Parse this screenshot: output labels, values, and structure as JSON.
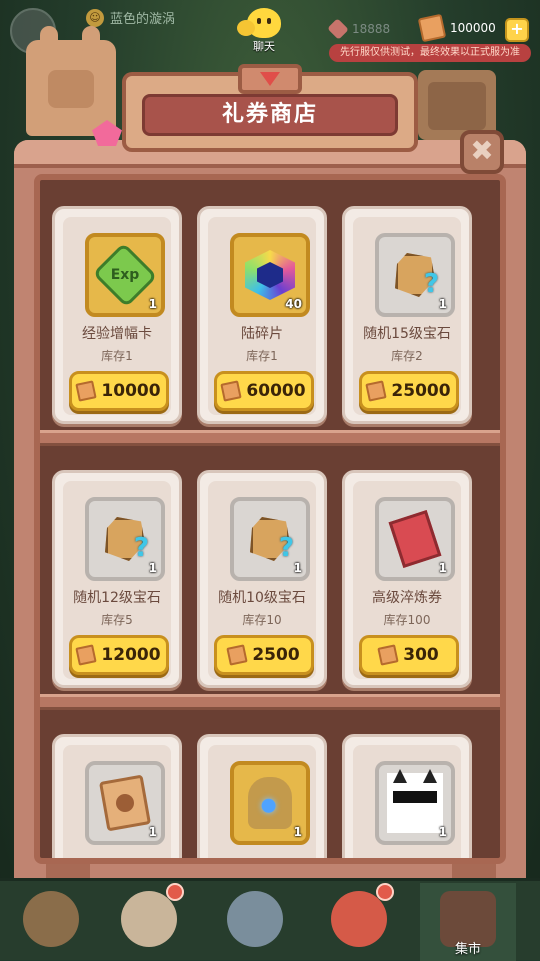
{
  "topbar": {
    "player_name": "蓝色的漩涡",
    "chat_label": "聊天",
    "gems": "18888",
    "coupons": "100000",
    "plus": "+",
    "notice": "先行服仅供测试，最终效果以正式服为准"
  },
  "shop": {
    "title": "礼券商店",
    "close_symbol": "✖",
    "items": [
      {
        "name": "经验增幅卡",
        "stock": "库存1",
        "price": "10000",
        "count": "1",
        "icon": "exp-card-icon",
        "icon_text": "Exp"
      },
      {
        "name": "陆碎片",
        "stock": "库存1",
        "price": "60000",
        "count": "40",
        "icon": "shard-icon"
      },
      {
        "name": "随机15级宝石",
        "stock": "库存2",
        "price": "25000",
        "count": "1",
        "icon": "random-gem-icon",
        "question": "?"
      },
      {
        "name": "随机12级宝石",
        "stock": "库存5",
        "price": "12000",
        "count": "1",
        "icon": "random-gem-icon",
        "question": "?"
      },
      {
        "name": "随机10级宝石",
        "stock": "库存10",
        "price": "2500",
        "count": "1",
        "icon": "random-gem-icon",
        "question": "?"
      },
      {
        "name": "高级淬炼券",
        "stock": "库存100",
        "price": "300",
        "count": "1",
        "icon": "refine-ticket-icon"
      },
      {
        "name": "",
        "stock": "",
        "price": "",
        "count": "1",
        "icon": "paw-coupon-icon"
      },
      {
        "name": "",
        "stock": "",
        "price": "",
        "count": "1",
        "icon": "bust-statue-icon"
      },
      {
        "name": "",
        "stock": "",
        "price": "",
        "count": "1",
        "icon": "cool-cat-icon"
      }
    ]
  },
  "nav": {
    "market_label": "集市"
  },
  "colors": {
    "price_button": "#ffd84a",
    "title_banner": "#a8534b",
    "notice": "#b84140"
  }
}
